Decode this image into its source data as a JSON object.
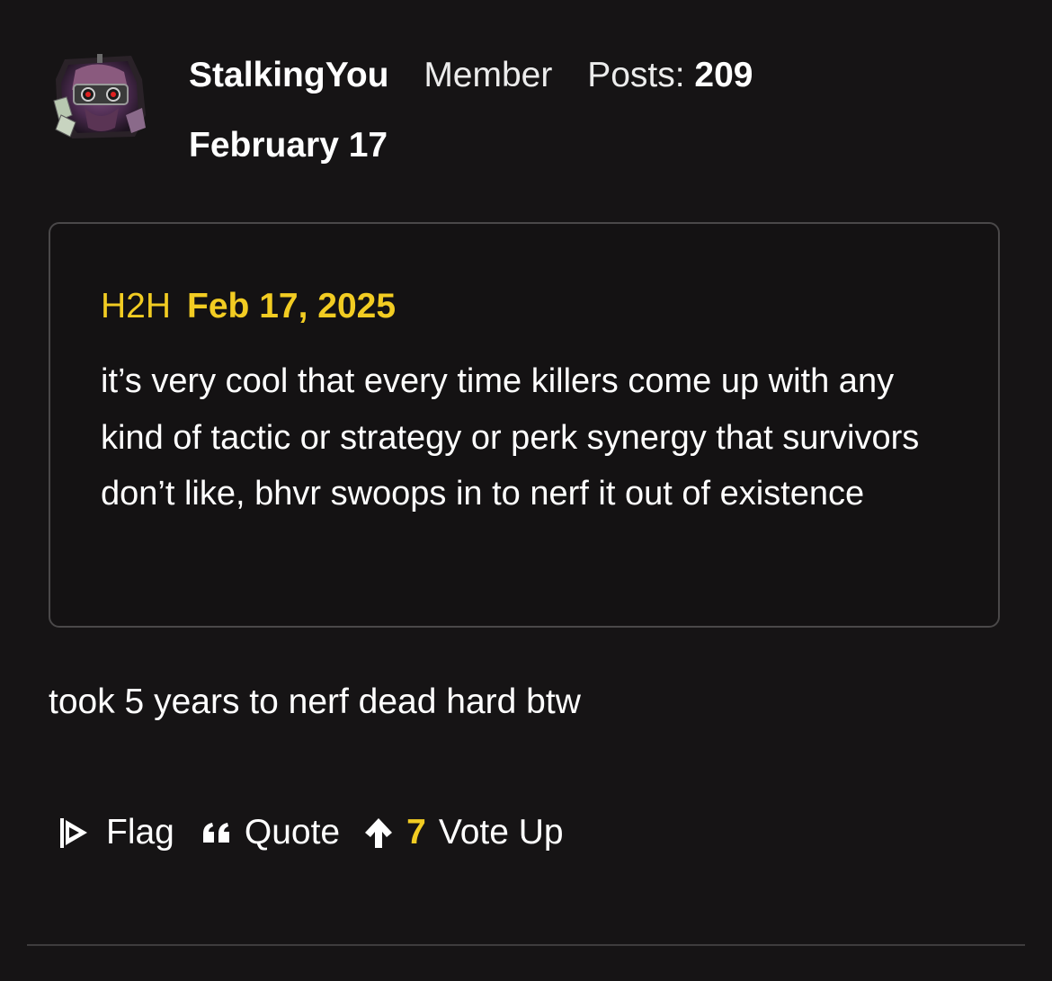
{
  "post": {
    "author": "StalkingYou",
    "role": "Member",
    "posts_label": "Posts:",
    "posts_count": "209",
    "date": "February 17",
    "avatar_icon": "killer-avatar-icon",
    "quote": {
      "author": "H2H",
      "date": "Feb 17, 2025",
      "body": "it’s very cool that every time killers come up with any kind of tactic or strategy or perk synergy that survivors don’t like, bhvr swoops in to nerf it out of existence"
    },
    "body": "took 5 years to nerf dead hard btw"
  },
  "actions": {
    "flag_label": "Flag",
    "flag_icon": "flag-icon",
    "quote_label": "Quote",
    "quote_icon": "quote-marks-icon",
    "vote_count": "7",
    "vote_label": "Vote Up",
    "vote_icon": "arrow-up-icon"
  },
  "colors": {
    "background": "#161415",
    "accent": "#f2cc22",
    "quote_border": "#4a4849",
    "text": "#ffffff"
  }
}
